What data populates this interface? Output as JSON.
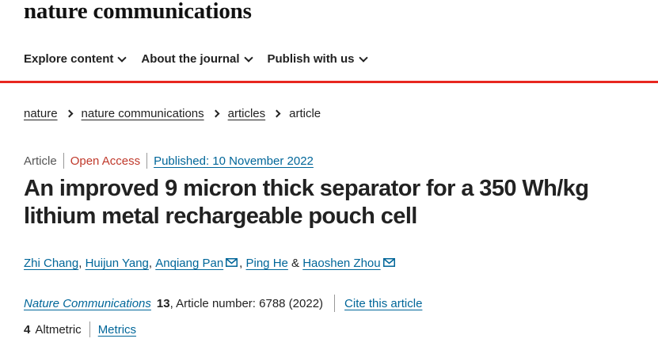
{
  "brand": {
    "name": "nature communications"
  },
  "nav": {
    "items": [
      {
        "label": "Explore content"
      },
      {
        "label": "About the journal"
      },
      {
        "label": "Publish with us"
      }
    ]
  },
  "colors": {
    "accent_rule": "#e8271f",
    "link": "#006699",
    "open_access": "#c0392b"
  },
  "breadcrumb": {
    "items": [
      {
        "label": "nature"
      },
      {
        "label": "nature communications"
      },
      {
        "label": "articles"
      },
      {
        "label": "article"
      }
    ]
  },
  "article": {
    "type": "Article",
    "access": "Open Access",
    "published": "Published: 10 November 2022",
    "title": "An improved 9  micron thick separator for a 350  Wh/kg lithium metal rechargeable pouch cell",
    "authors": [
      {
        "name": "Zhi Chang",
        "after": ", "
      },
      {
        "name": "Huijun Yang",
        "after": ", "
      },
      {
        "name": "Anqiang Pan",
        "after": ", "
      },
      {
        "name": "Ping He",
        "after": " & "
      },
      {
        "name": "Haoshen Zhou",
        "after": ""
      }
    ],
    "conjunction": "&",
    "journal": "Nature Communications",
    "volume": "13",
    "article_number": ", Article number: 6788 (2022)",
    "cite_label": "Cite this article",
    "altmetric_score": "4",
    "altmetric_label": "Altmetric",
    "metrics_label": "Metrics"
  },
  "icons": {
    "mail": "mail-icon",
    "chevron": "chevron-down-icon",
    "crumb_sep": "chevron-right-icon"
  }
}
